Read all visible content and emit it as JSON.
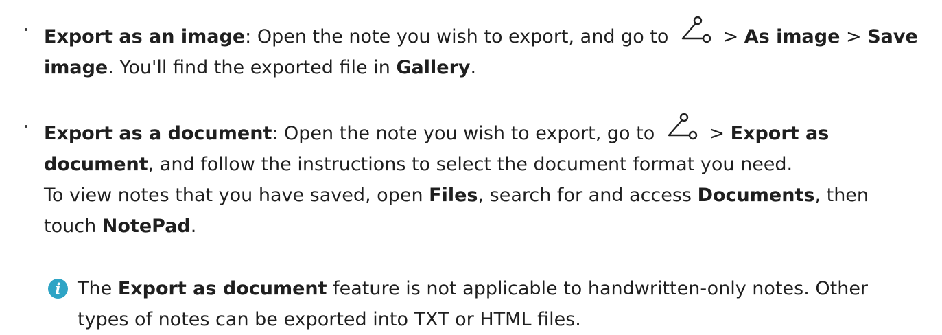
{
  "bullets": [
    {
      "line1": {
        "title": "Export as an image",
        "colon": ": Open the note you wish to export, and go to ",
        "icon": "share-icon",
        "gt1": " > ",
        "step1": "As image",
        "gt2": " > ",
        "step2": "Save"
      },
      "line2": {
        "step2_cont": "image",
        "text": ". You'll find the exported file in ",
        "location": "Gallery",
        "end": "."
      }
    },
    {
      "line1": {
        "title": "Export as a document",
        "colon": ": Open the note you wish to export, go to ",
        "icon": "share-icon",
        "gt1": " > ",
        "step1": "Export as"
      },
      "line2": {
        "step1_cont": "document",
        "text": ", and follow the instructions to select the document format you need."
      },
      "line3": {
        "text1": "To view notes that you have saved, open ",
        "app": "Files",
        "text2": ", search for and access ",
        "folder": "Documents",
        "text3": ", then"
      },
      "line4": {
        "text1": "touch ",
        "app": "NotePad",
        "end": "."
      }
    }
  ],
  "note": {
    "icon": "info-icon",
    "icon_glyph": "i",
    "icon_color": "#2ea4c5",
    "line1_a": "The ",
    "line1_b": "Export as document",
    "line1_c": " feature is not applicable to handwritten-only notes. Other",
    "line2": "types of notes can be exported into TXT or HTML files."
  }
}
